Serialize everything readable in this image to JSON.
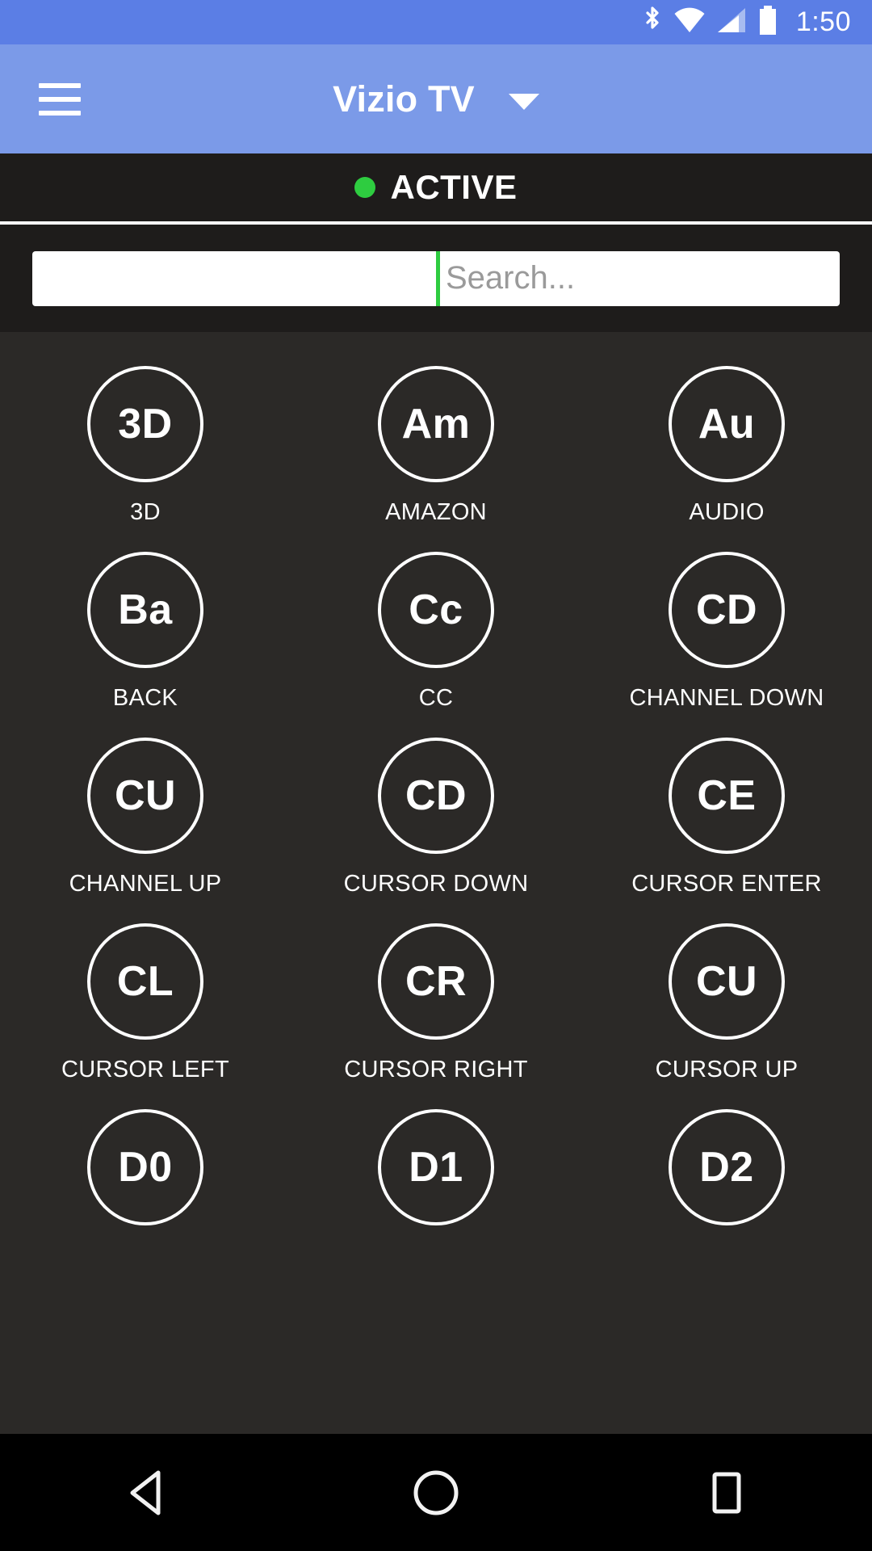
{
  "status_bar": {
    "time": "1:50",
    "icons": [
      "bluetooth-icon",
      "wifi-icon",
      "cellular-signal-icon",
      "battery-icon"
    ],
    "background_color": "#5b7ee5"
  },
  "app_bar": {
    "menu_icon": "hamburger-menu-icon",
    "title": "Vizio TV",
    "dropdown_icon": "chevron-down-icon",
    "background_color": "#7b9ae8"
  },
  "connection_status": {
    "label": "ACTIVE",
    "indicator_color": "#2ecc40"
  },
  "search": {
    "value": "",
    "placeholder": "Search...",
    "cursor_color": "#2ecc40"
  },
  "buttons": [
    {
      "abbr": "3D",
      "label": "3D"
    },
    {
      "abbr": "Am",
      "label": "AMAZON"
    },
    {
      "abbr": "Au",
      "label": "AUDIO"
    },
    {
      "abbr": "Ba",
      "label": "BACK"
    },
    {
      "abbr": "Cc",
      "label": "CC"
    },
    {
      "abbr": "CD",
      "label": "CHANNEL DOWN"
    },
    {
      "abbr": "CU",
      "label": "CHANNEL UP"
    },
    {
      "abbr": "CD",
      "label": "CURSOR DOWN"
    },
    {
      "abbr": "CE",
      "label": "CURSOR ENTER"
    },
    {
      "abbr": "CL",
      "label": "CURSOR LEFT"
    },
    {
      "abbr": "CR",
      "label": "CURSOR RIGHT"
    },
    {
      "abbr": "CU",
      "label": "CURSOR UP"
    },
    {
      "abbr": "D0",
      "label": ""
    },
    {
      "abbr": "D1",
      "label": ""
    },
    {
      "abbr": "D2",
      "label": ""
    }
  ],
  "nav_bar": {
    "back": "back-triangle-icon",
    "home": "home-circle-icon",
    "recents": "recents-square-icon"
  }
}
